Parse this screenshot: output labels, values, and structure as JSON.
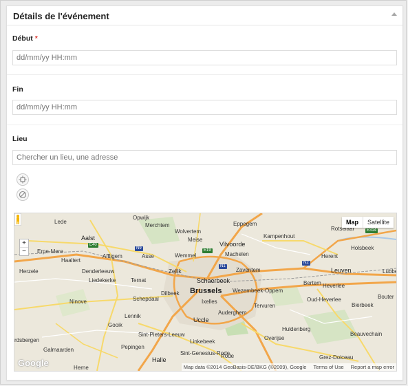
{
  "box": {
    "title": "Détails de l'événement"
  },
  "fields": {
    "start": {
      "label": "Début",
      "required_mark": "*",
      "placeholder": "dd/mm/yy HH:mm"
    },
    "end": {
      "label": "Fin",
      "placeholder": "dd/mm/yy HH:mm"
    },
    "place": {
      "label": "Lieu",
      "placeholder": "Chercher un lieu, une adresse"
    }
  },
  "map": {
    "type_buttons": [
      "Map",
      "Satellite"
    ],
    "active_type": "Map",
    "zoom": {
      "in": "+",
      "out": "−"
    },
    "logo": "Google",
    "attribution": {
      "data": "Map data ©2014 GeoBasis-DE/BKG (©2009), Google",
      "terms": "Terms of Use",
      "report": "Report a map error"
    },
    "cities": [
      {
        "name": "Brussels",
        "size": "big"
      },
      {
        "name": "Schaerbeek",
        "size": "mid"
      },
      {
        "name": "Leuven",
        "size": "mid"
      },
      {
        "name": "Aalst",
        "size": "mid"
      },
      {
        "name": "Vilvoorde",
        "size": "mid"
      },
      {
        "name": "Uccle",
        "size": "mid"
      },
      {
        "name": "Lede"
      },
      {
        "name": "Opwijk"
      },
      {
        "name": "Merchtem"
      },
      {
        "name": "Wolvertem"
      },
      {
        "name": "Eppegem"
      },
      {
        "name": "Rotselaar"
      },
      {
        "name": "Meise"
      },
      {
        "name": "Kampenhout"
      },
      {
        "name": "Erpe-Mere"
      },
      {
        "name": "Haaltert"
      },
      {
        "name": "Affligem"
      },
      {
        "name": "Asse"
      },
      {
        "name": "Wemmel"
      },
      {
        "name": "Machelen"
      },
      {
        "name": "Holsbeek"
      },
      {
        "name": "Herent"
      },
      {
        "name": "Herzele"
      },
      {
        "name": "Denderleeuw"
      },
      {
        "name": "Liedekerke"
      },
      {
        "name": "Ternat"
      },
      {
        "name": "Zellik"
      },
      {
        "name": "Zaventem"
      },
      {
        "name": "Bertem"
      },
      {
        "name": "Heverlee"
      },
      {
        "name": "Lubbe"
      },
      {
        "name": "Dilbeek"
      },
      {
        "name": "Wezembeek-Oppem"
      },
      {
        "name": "Bouter"
      },
      {
        "name": "Ninove"
      },
      {
        "name": "Schepdaal"
      },
      {
        "name": "Ixelles"
      },
      {
        "name": "Tervuren"
      },
      {
        "name": "Oud-Heverlee"
      },
      {
        "name": "Bierbeek"
      },
      {
        "name": "Auderghem"
      },
      {
        "name": "Lennik"
      },
      {
        "name": "Gooik"
      },
      {
        "name": "Sint-Pieters-Leeuw"
      },
      {
        "name": "Linkebeek"
      },
      {
        "name": "Overijse"
      },
      {
        "name": "Beauvechain"
      },
      {
        "name": "Huldenberg"
      },
      {
        "name": "rdsbergen"
      },
      {
        "name": "Galmaarden"
      },
      {
        "name": "Pepingen"
      },
      {
        "name": "Sint-Genesius-Rode"
      },
      {
        "name": "Herne"
      },
      {
        "name": "Halle"
      },
      {
        "name": "Rode"
      },
      {
        "name": "Grez-Doiceau"
      }
    ],
    "road_shields": [
      "E40",
      "N9",
      "E19",
      "N1",
      "N2",
      "E314"
    ]
  }
}
